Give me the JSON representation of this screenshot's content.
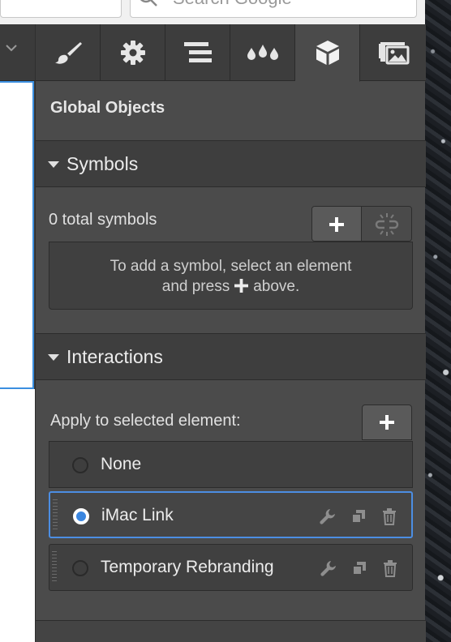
{
  "browser": {
    "search_placeholder": "Search Google"
  },
  "panel": {
    "tabs": [
      {
        "icon": "brush-icon"
      },
      {
        "icon": "gear-icon"
      },
      {
        "icon": "navigator-icon"
      },
      {
        "icon": "drops-icon"
      },
      {
        "icon": "cube-icon",
        "active": true
      },
      {
        "icon": "assets-icon"
      }
    ],
    "title": "Global Objects",
    "symbols": {
      "heading": "Symbols",
      "count_text": "0 total symbols",
      "empty_line1": "To add a symbol, select an element",
      "empty_line2_before": "and press",
      "empty_line2_after": "above."
    },
    "interactions": {
      "heading": "Interactions",
      "apply_label": "Apply to selected element:",
      "items": [
        {
          "name": "None",
          "selected": false
        },
        {
          "name": "iMac Link",
          "selected": true
        },
        {
          "name": "Temporary Rebranding",
          "selected": false
        }
      ]
    }
  },
  "colors": {
    "accent": "#4c8ee3",
    "panel_bg": "#4b4b4b",
    "header_bg": "#3e3e3e"
  }
}
